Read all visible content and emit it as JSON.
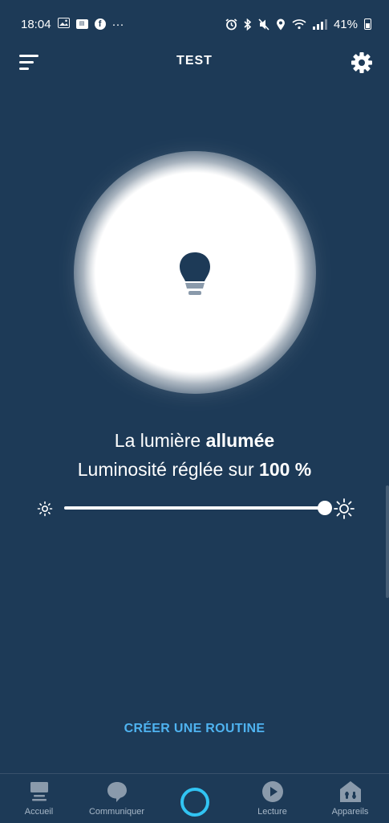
{
  "status_bar": {
    "time": "18:04",
    "more": "···",
    "battery_text": "41%",
    "left_icons": [
      "image-icon",
      "news-icon",
      "facebook-icon",
      "more-icon"
    ],
    "right_icons": [
      "alarm-icon",
      "bluetooth-icon",
      "mute-icon",
      "location-icon",
      "wifi-icon",
      "signal-icon",
      "battery-icon"
    ]
  },
  "header": {
    "title": "TEST",
    "menu_icon": "menu-icon",
    "settings_icon": "gear-icon"
  },
  "light": {
    "state_prefix": "La lumière ",
    "state_value": "allumée",
    "brightness_prefix": "Luminosité réglée sur ",
    "brightness_value": "100 %",
    "brightness_level": 1.0,
    "icon": "bulb-icon"
  },
  "slider": {
    "min_icon": "sun-small-icon",
    "max_icon": "sun-large-icon"
  },
  "routine": {
    "label": "CRÉER UNE ROUTINE"
  },
  "nav": {
    "items": [
      {
        "label": "Accueil",
        "icon": "home-icon"
      },
      {
        "label": "Communiquer",
        "icon": "chat-icon"
      },
      {
        "label": "",
        "icon": "alexa-icon"
      },
      {
        "label": "Lecture",
        "icon": "play-icon"
      },
      {
        "label": "Appareils",
        "icon": "devices-icon"
      }
    ]
  },
  "colors": {
    "background": "#1d3a57",
    "accent": "#4fb3f0",
    "alexa": "#31c4f3",
    "text": "#ffffff",
    "nav_label": "#a8b8c8"
  }
}
